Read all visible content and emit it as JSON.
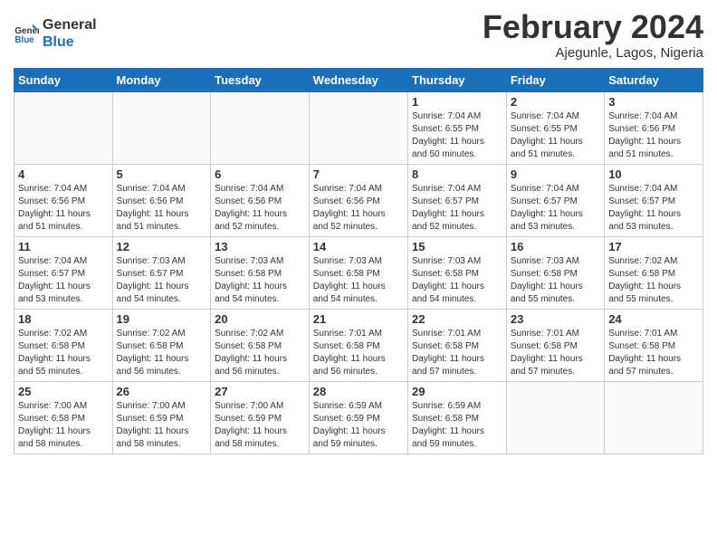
{
  "logo": {
    "line1": "General",
    "line2": "Blue"
  },
  "title": "February 2024",
  "location": "Ajegunle, Lagos, Nigeria",
  "weekdays": [
    "Sunday",
    "Monday",
    "Tuesday",
    "Wednesday",
    "Thursday",
    "Friday",
    "Saturday"
  ],
  "weeks": [
    [
      {
        "day": "",
        "info": ""
      },
      {
        "day": "",
        "info": ""
      },
      {
        "day": "",
        "info": ""
      },
      {
        "day": "",
        "info": ""
      },
      {
        "day": "1",
        "info": "Sunrise: 7:04 AM\nSunset: 6:55 PM\nDaylight: 11 hours\nand 50 minutes."
      },
      {
        "day": "2",
        "info": "Sunrise: 7:04 AM\nSunset: 6:55 PM\nDaylight: 11 hours\nand 51 minutes."
      },
      {
        "day": "3",
        "info": "Sunrise: 7:04 AM\nSunset: 6:56 PM\nDaylight: 11 hours\nand 51 minutes."
      }
    ],
    [
      {
        "day": "4",
        "info": "Sunrise: 7:04 AM\nSunset: 6:56 PM\nDaylight: 11 hours\nand 51 minutes."
      },
      {
        "day": "5",
        "info": "Sunrise: 7:04 AM\nSunset: 6:56 PM\nDaylight: 11 hours\nand 51 minutes."
      },
      {
        "day": "6",
        "info": "Sunrise: 7:04 AM\nSunset: 6:56 PM\nDaylight: 11 hours\nand 52 minutes."
      },
      {
        "day": "7",
        "info": "Sunrise: 7:04 AM\nSunset: 6:56 PM\nDaylight: 11 hours\nand 52 minutes."
      },
      {
        "day": "8",
        "info": "Sunrise: 7:04 AM\nSunset: 6:57 PM\nDaylight: 11 hours\nand 52 minutes."
      },
      {
        "day": "9",
        "info": "Sunrise: 7:04 AM\nSunset: 6:57 PM\nDaylight: 11 hours\nand 53 minutes."
      },
      {
        "day": "10",
        "info": "Sunrise: 7:04 AM\nSunset: 6:57 PM\nDaylight: 11 hours\nand 53 minutes."
      }
    ],
    [
      {
        "day": "11",
        "info": "Sunrise: 7:04 AM\nSunset: 6:57 PM\nDaylight: 11 hours\nand 53 minutes."
      },
      {
        "day": "12",
        "info": "Sunrise: 7:03 AM\nSunset: 6:57 PM\nDaylight: 11 hours\nand 54 minutes."
      },
      {
        "day": "13",
        "info": "Sunrise: 7:03 AM\nSunset: 6:58 PM\nDaylight: 11 hours\nand 54 minutes."
      },
      {
        "day": "14",
        "info": "Sunrise: 7:03 AM\nSunset: 6:58 PM\nDaylight: 11 hours\nand 54 minutes."
      },
      {
        "day": "15",
        "info": "Sunrise: 7:03 AM\nSunset: 6:58 PM\nDaylight: 11 hours\nand 54 minutes."
      },
      {
        "day": "16",
        "info": "Sunrise: 7:03 AM\nSunset: 6:58 PM\nDaylight: 11 hours\nand 55 minutes."
      },
      {
        "day": "17",
        "info": "Sunrise: 7:02 AM\nSunset: 6:58 PM\nDaylight: 11 hours\nand 55 minutes."
      }
    ],
    [
      {
        "day": "18",
        "info": "Sunrise: 7:02 AM\nSunset: 6:58 PM\nDaylight: 11 hours\nand 55 minutes."
      },
      {
        "day": "19",
        "info": "Sunrise: 7:02 AM\nSunset: 6:58 PM\nDaylight: 11 hours\nand 56 minutes."
      },
      {
        "day": "20",
        "info": "Sunrise: 7:02 AM\nSunset: 6:58 PM\nDaylight: 11 hours\nand 56 minutes."
      },
      {
        "day": "21",
        "info": "Sunrise: 7:01 AM\nSunset: 6:58 PM\nDaylight: 11 hours\nand 56 minutes."
      },
      {
        "day": "22",
        "info": "Sunrise: 7:01 AM\nSunset: 6:58 PM\nDaylight: 11 hours\nand 57 minutes."
      },
      {
        "day": "23",
        "info": "Sunrise: 7:01 AM\nSunset: 6:58 PM\nDaylight: 11 hours\nand 57 minutes."
      },
      {
        "day": "24",
        "info": "Sunrise: 7:01 AM\nSunset: 6:58 PM\nDaylight: 11 hours\nand 57 minutes."
      }
    ],
    [
      {
        "day": "25",
        "info": "Sunrise: 7:00 AM\nSunset: 6:58 PM\nDaylight: 11 hours\nand 58 minutes."
      },
      {
        "day": "26",
        "info": "Sunrise: 7:00 AM\nSunset: 6:59 PM\nDaylight: 11 hours\nand 58 minutes."
      },
      {
        "day": "27",
        "info": "Sunrise: 7:00 AM\nSunset: 6:59 PM\nDaylight: 11 hours\nand 58 minutes."
      },
      {
        "day": "28",
        "info": "Sunrise: 6:59 AM\nSunset: 6:59 PM\nDaylight: 11 hours\nand 59 minutes."
      },
      {
        "day": "29",
        "info": "Sunrise: 6:59 AM\nSunset: 6:58 PM\nDaylight: 11 hours\nand 59 minutes."
      },
      {
        "day": "",
        "info": ""
      },
      {
        "day": "",
        "info": ""
      }
    ]
  ]
}
